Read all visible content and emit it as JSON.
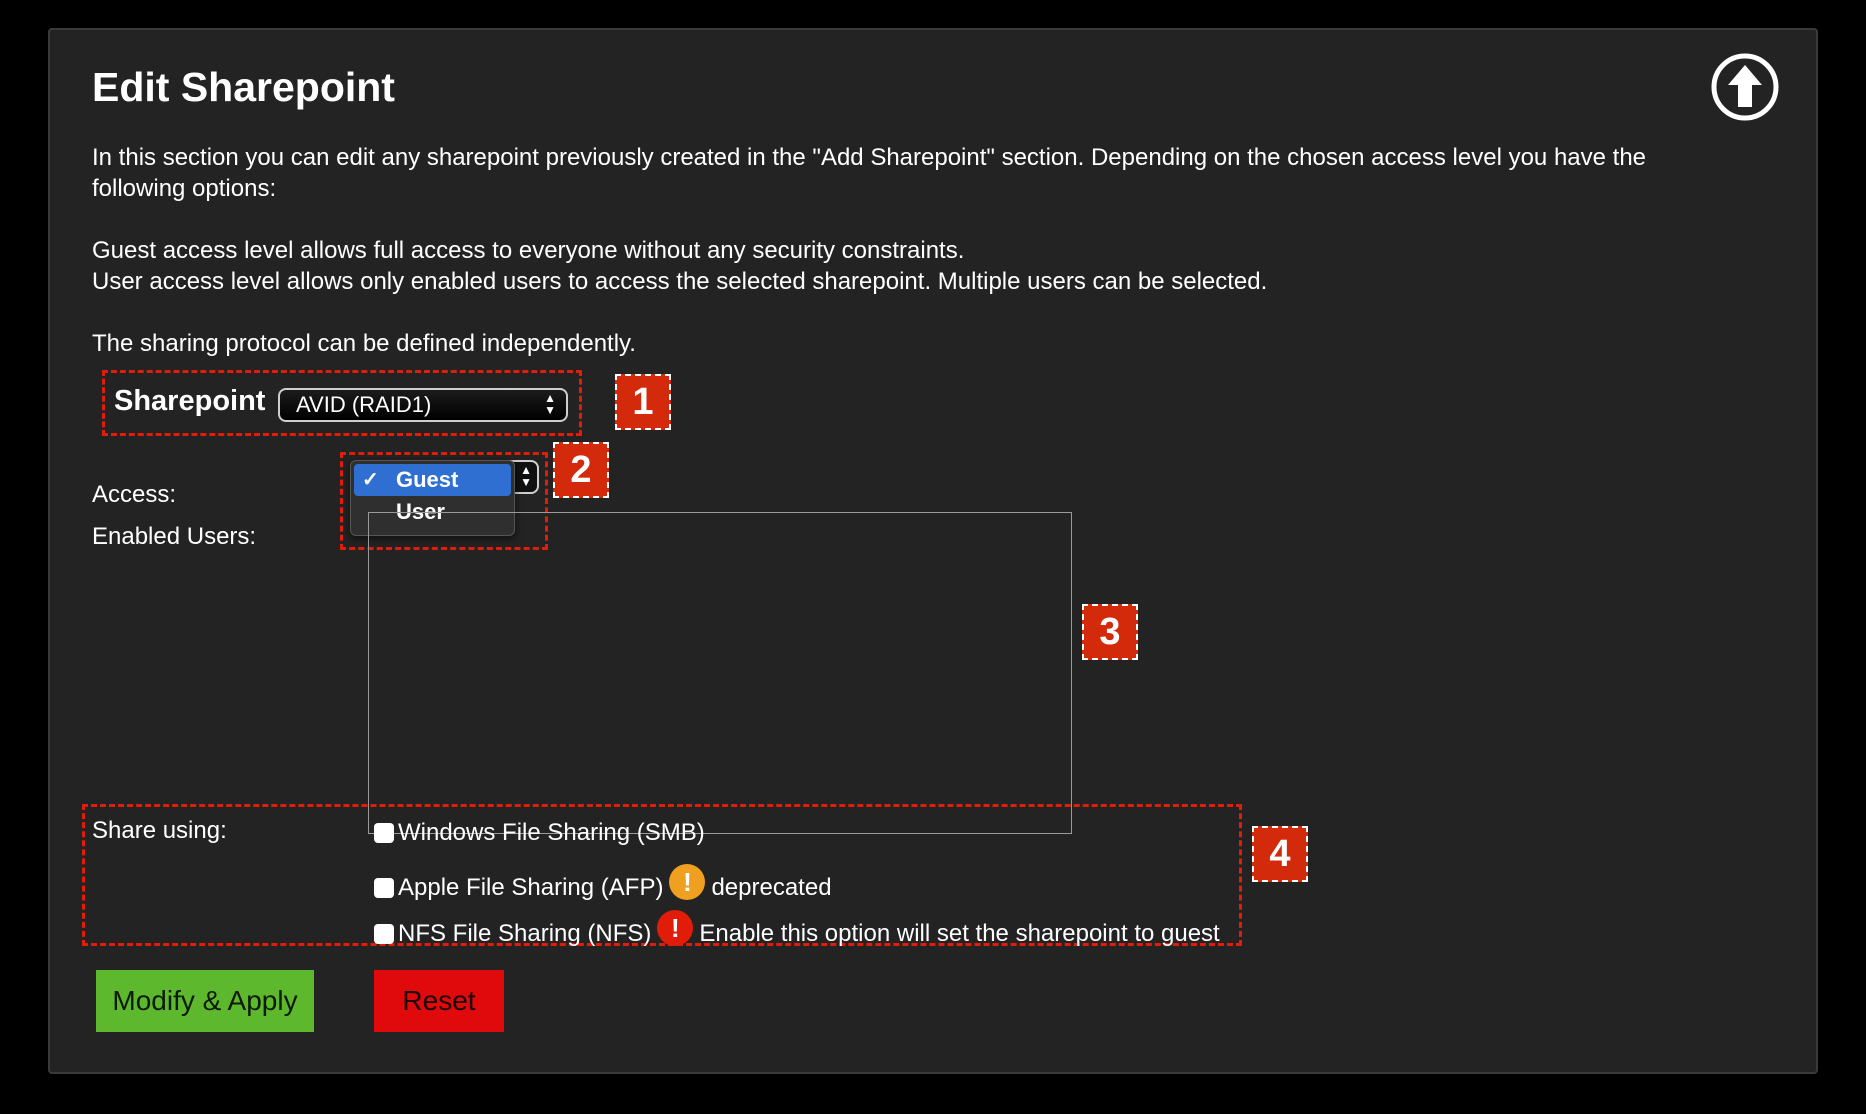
{
  "header": {
    "title": "Edit Sharepoint"
  },
  "intro": {
    "para1": "In this section you can edit any sharepoint previously created in the \"Add Sharepoint\" section. Depending on the chosen access level you have the following options:",
    "guest_line": "Guest access level allows full access to everyone without any security constraints.",
    "user_line": "User access level allows only enabled users to access the selected sharepoint. Multiple users can be selected.",
    "protocol_line": "The sharing protocol can be defined independently."
  },
  "sharepoint": {
    "label": "Sharepoint",
    "selected": "AVID (RAID1)"
  },
  "access": {
    "label": "Access:",
    "options": [
      "Guest",
      "User"
    ],
    "selected": "Guest",
    "check_glyph": "✓"
  },
  "enabled_users": {
    "label": "Enabled Users:"
  },
  "share_using": {
    "label": "Share using:",
    "smb_label": "Windows File Sharing (SMB)",
    "afp_label": "Apple File Sharing (AFP)",
    "afp_note": "deprecated",
    "nfs_label": "NFS File Sharing (NFS)",
    "nfs_note": "Enable this option will set the sharepoint to guest",
    "icon_glyph": "!"
  },
  "callouts": [
    "1",
    "2",
    "3",
    "4"
  ],
  "buttons": {
    "apply": "Modify & Apply",
    "reset": "Reset"
  },
  "colors": {
    "background": "#000000",
    "panel": "#232323",
    "highlight": "#e11d0a",
    "badge": "#d42a0c",
    "apply": "#5db82d",
    "reset": "#e0090b",
    "menu_selected": "#2f6fd1",
    "warning": "#f0a020",
    "error": "#e11d0a"
  },
  "icons": {
    "top": "arrow-up-circle-icon",
    "afp_warning": "exclamation-circle-icon",
    "nfs_error": "exclamation-circle-icon"
  }
}
